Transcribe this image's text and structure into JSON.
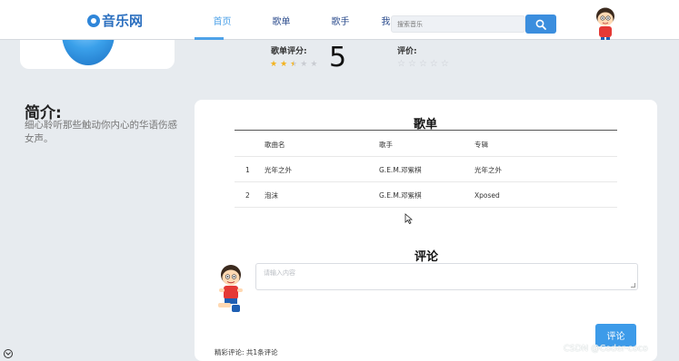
{
  "header": {
    "logo": "音乐网",
    "nav": [
      "首页",
      "歌单",
      "歌手",
      "我的音乐"
    ],
    "active_nav": "首页",
    "search_placeholder": "搜索音乐"
  },
  "rating": {
    "score_label": "歌单评分:",
    "score_value": "5",
    "score_stars": 2.5,
    "your_rating_label": "评价:",
    "your_rating_stars": 0
  },
  "intro": {
    "title": "简介:",
    "text": "细心聆听那些触动你内心的华语伤感女声。"
  },
  "playlist": {
    "title": "歌单",
    "columns": [
      "歌曲名",
      "歌手",
      "专辑"
    ],
    "rows": [
      {
        "no": "1",
        "name": "光年之外",
        "singer": "G.E.M.邓紫棋",
        "album": "光年之外"
      },
      {
        "no": "2",
        "name": "泡沫",
        "singer": "G.E.M.邓紫棋",
        "album": "Xposed"
      }
    ]
  },
  "comments": {
    "title": "评论",
    "placeholder": "请输入内容",
    "button": "评论",
    "count_text": "精彩评论: 共1条评论"
  },
  "watermark": "CSDN @Coder-coco",
  "colors": {
    "accent": "#3d9be9",
    "star": "#f3b320"
  }
}
